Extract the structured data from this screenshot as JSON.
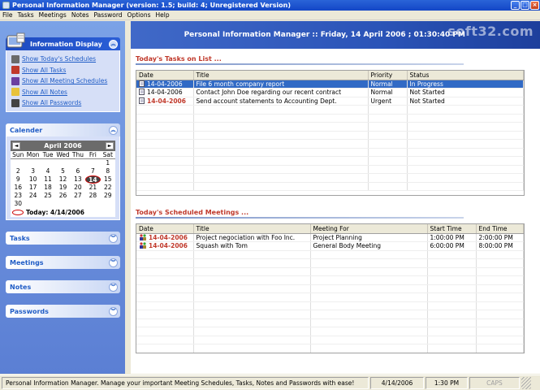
{
  "window": {
    "title": "Personal Information Manager (version: 1.5; build: 4; Unregistered Version)",
    "controls": [
      "_",
      "□",
      "×"
    ]
  },
  "menu": [
    "File",
    "Tasks",
    "Meetings",
    "Notes",
    "Password",
    "Options",
    "Help"
  ],
  "sidebar": {
    "display": {
      "title": "Information Display",
      "links": [
        {
          "label": "Show Today's Schedules",
          "icon": "schedule-icon",
          "color": "#6a6a6a"
        },
        {
          "label": "Show All Tasks",
          "icon": "tasks-icon",
          "color": "#c0392b"
        },
        {
          "label": "Show All Meeting Schedules",
          "icon": "meetings-icon",
          "color": "#6b3fa0"
        },
        {
          "label": "Show All Notes",
          "icon": "notes-icon",
          "color": "#e8c23a"
        },
        {
          "label": "Show All Passwords",
          "icon": "passwords-icon",
          "color": "#444444"
        }
      ]
    },
    "calendar": {
      "title": "Calender",
      "month": "April 2006",
      "prev": "◄",
      "next": "►",
      "weekdays": [
        "Sun",
        "Mon",
        "Tue",
        "Wed",
        "Thu",
        "Fri",
        "Sat"
      ],
      "weeks": [
        [
          "",
          "",
          "",
          "",
          "",
          "",
          "1"
        ],
        [
          "2",
          "3",
          "4",
          "5",
          "6",
          "7",
          "8"
        ],
        [
          "9",
          "10",
          "11",
          "12",
          "13",
          "14",
          "15"
        ],
        [
          "16",
          "17",
          "18",
          "19",
          "20",
          "21",
          "22"
        ],
        [
          "23",
          "24",
          "25",
          "26",
          "27",
          "28",
          "29"
        ],
        [
          "30",
          "",
          "",
          "",
          "",
          "",
          ""
        ]
      ],
      "today_day": "14",
      "today_label": "Today: 4/14/2006"
    },
    "groups": [
      "Tasks",
      "Meetings",
      "Notes",
      "Passwords"
    ]
  },
  "banner": {
    "text": "Personal Information Manager :: Friday, 14 April 2006 ; 01:30:40 PM",
    "watermark": "soft32.com"
  },
  "tasks": {
    "title": "Today's Tasks on List ...",
    "columns": [
      "Date",
      "Title",
      "Priority",
      "Status"
    ],
    "rows": [
      {
        "date": "14-04-2006",
        "title": "File 6 month company report",
        "priority": "Normal",
        "status": "In Progress",
        "selected": true,
        "red": false
      },
      {
        "date": "14-04-2006",
        "title": "Contact John Doe regarding our recent contract",
        "priority": "Normal",
        "status": "Not Started",
        "selected": false,
        "red": false
      },
      {
        "date": "14-04-2006",
        "title": "Send account statements to Accounting Dept.",
        "priority": "Urgent",
        "status": "Not Started",
        "selected": false,
        "red": true
      }
    ]
  },
  "meetings": {
    "title": "Today's Scheduled Meetings ...",
    "columns": [
      "Date",
      "Title",
      "Meeting For",
      "Start Time",
      "End Time"
    ],
    "rows": [
      {
        "date": "14-04-2006",
        "title": "Project negociation with Foo Inc.",
        "for": "Project Planning",
        "start": "1:00:00 PM",
        "end": "2:00:00 PM"
      },
      {
        "date": "14-04-2006",
        "title": "Squash with Tom",
        "for": "General Body Meeting",
        "start": "6:00:00 PM",
        "end": "8:00:00 PM"
      }
    ]
  },
  "status": {
    "message": "Personal Information Manager. Manage your important Meeting Schedules, Tasks, Notes and Passwords with ease!",
    "date": "4/14/2006",
    "time": "1:30 PM",
    "caps": "CAPS"
  }
}
